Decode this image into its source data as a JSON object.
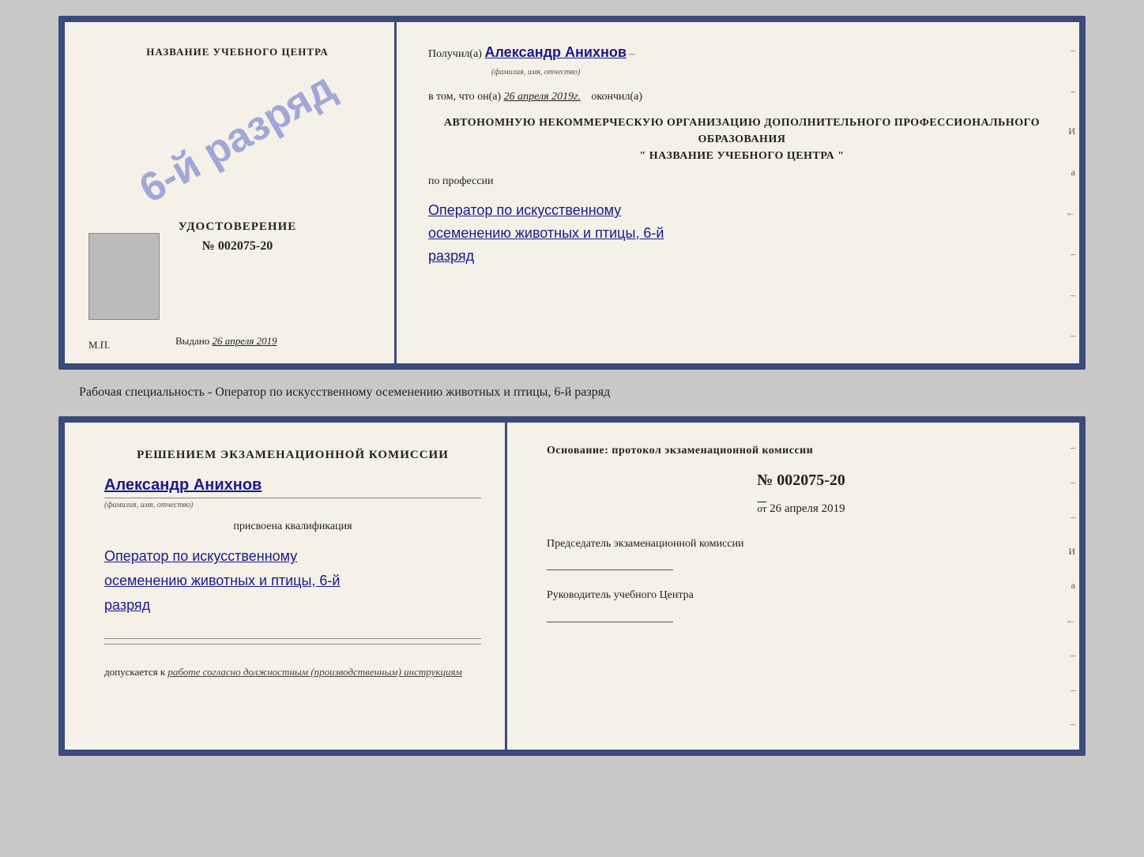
{
  "top_document": {
    "left": {
      "school_name": "НАЗВАНИЕ УЧЕБНОГО ЦЕНТРА",
      "stamp_text": "6-й разряд",
      "udostoverenie_title": "УДОСТОВЕРЕНИЕ",
      "udostoverenie_number": "№ 002075-20",
      "vydano_label": "Выдано",
      "vydano_date": "26 апреля 2019",
      "mp_label": "М.П."
    },
    "right": {
      "received_prefix": "Получил(а)",
      "received_name": "Александр Анихнов",
      "received_subtitle": "(фамилия, имя, отчество)",
      "date_prefix": "в том, что он(а)",
      "date_value": "26 апреля 2019г.",
      "date_suffix": "окончил(а)",
      "org_text": "АВТОНОМНУЮ НЕКОММЕРЧЕСКУЮ ОРГАНИЗАЦИЮ ДОПОЛНИТЕЛЬНОГО ПРОФЕССИОНАЛЬНОГО ОБРАЗОВАНИЯ",
      "school_label_quote": "\" НАЗВАНИЕ УЧЕБНОГО ЦЕНТРА \"",
      "profession_label": "по профессии",
      "profession_value": "Оператор по искусственному осеменению животных и птицы, 6-й разряд"
    }
  },
  "subtitle": "Рабочая специальность - Оператор по искусственному осеменению животных и птицы, 6-й разряд",
  "bottom_document": {
    "left": {
      "komissia_title": "Решением экзаменационной комиссии",
      "person_name": "Александр Анихнов",
      "person_subtitle": "(фамилия, имя, отчество)",
      "assigned_label": "присвоена квалификация",
      "qualification_value": "Оператор по искусственному осеменению животных и птицы, 6-й разряд",
      "dopuskaetsya_prefix": "допускается к",
      "dopuskaetsya_value": "работе согласно должностным (производственным) инструкциям"
    },
    "right": {
      "osnование_title": "Основание: протокол экзаменационной комиссии",
      "protocol_number": "№ 002075-20",
      "protocol_date_prefix": "от",
      "protocol_date": "26 апреля 2019",
      "chairman_title": "Председатель экзаменационной комиссии",
      "director_title": "Руководитель учебного Центра"
    }
  }
}
